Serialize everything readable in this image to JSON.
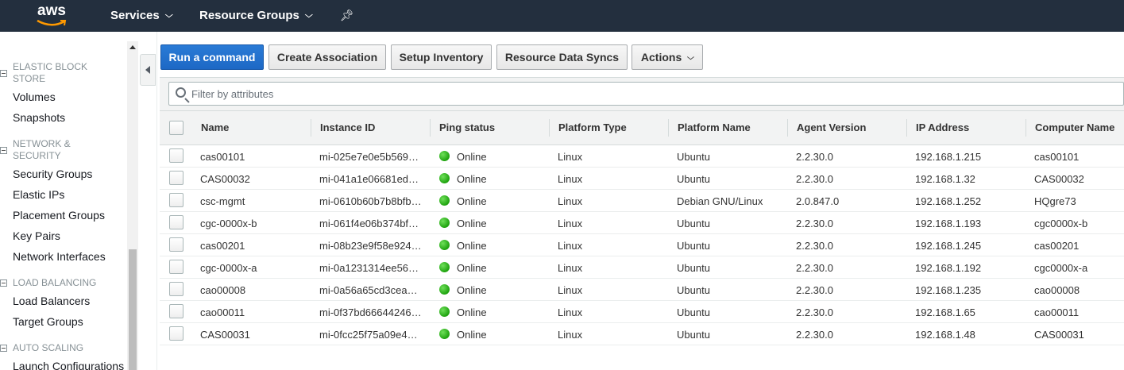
{
  "topbar": {
    "logo": "aws",
    "nav": [
      {
        "label": "Services"
      },
      {
        "label": "Resource Groups"
      }
    ]
  },
  "sidebar": {
    "sections": [
      {
        "title": "ELASTIC BLOCK STORE",
        "items": [
          "Volumes",
          "Snapshots"
        ]
      },
      {
        "title": "NETWORK & SECURITY",
        "items": [
          "Security Groups",
          "Elastic IPs",
          "Placement Groups",
          "Key Pairs",
          "Network Interfaces"
        ]
      },
      {
        "title": "LOAD BALANCING",
        "items": [
          "Load Balancers",
          "Target Groups"
        ]
      },
      {
        "title": "AUTO SCALING",
        "items": [
          "Launch Configurations"
        ]
      }
    ]
  },
  "toolbar": {
    "run_command": "Run a command",
    "create_association": "Create Association",
    "setup_inventory": "Setup Inventory",
    "resource_data_syncs": "Resource Data Syncs",
    "actions": "Actions"
  },
  "filter": {
    "placeholder": "Filter by attributes",
    "value": ""
  },
  "table": {
    "columns": [
      "Name",
      "Instance ID",
      "Ping status",
      "Platform Type",
      "Platform Name",
      "Agent Version",
      "IP Address",
      "Computer Name"
    ],
    "rows": [
      {
        "name": "cas00101",
        "instance_id": "mi-025e7e0e5b569…",
        "ping": "Online",
        "platform_type": "Linux",
        "platform_name": "Ubuntu",
        "agent_version": "2.2.30.0",
        "ip": "192.168.1.215",
        "computer_name": "cas00101"
      },
      {
        "name": "CAS00032",
        "instance_id": "mi-041a1e06681ed…",
        "ping": "Online",
        "platform_type": "Linux",
        "platform_name": "Ubuntu",
        "agent_version": "2.2.30.0",
        "ip": "192.168.1.32",
        "computer_name": "CAS00032"
      },
      {
        "name": "csc-mgmt",
        "instance_id": "mi-0610b60b7b8bfb…",
        "ping": "Online",
        "platform_type": "Linux",
        "platform_name": "Debian GNU/Linux",
        "agent_version": "2.0.847.0",
        "ip": "192.168.1.252",
        "computer_name": "HQgre73"
      },
      {
        "name": "cgc-0000x-b",
        "instance_id": "mi-061f4e06b374bf…",
        "ping": "Online",
        "platform_type": "Linux",
        "platform_name": "Ubuntu",
        "agent_version": "2.2.30.0",
        "ip": "192.168.1.193",
        "computer_name": "cgc0000x-b"
      },
      {
        "name": "cas00201",
        "instance_id": "mi-08b23e9f58e924…",
        "ping": "Online",
        "platform_type": "Linux",
        "platform_name": "Ubuntu",
        "agent_version": "2.2.30.0",
        "ip": "192.168.1.245",
        "computer_name": "cas00201"
      },
      {
        "name": "cgc-0000x-a",
        "instance_id": "mi-0a1231314ee56…",
        "ping": "Online",
        "platform_type": "Linux",
        "platform_name": "Ubuntu",
        "agent_version": "2.2.30.0",
        "ip": "192.168.1.192",
        "computer_name": "cgc0000x-a"
      },
      {
        "name": "cao00008",
        "instance_id": "mi-0a56a65cd3cea…",
        "ping": "Online",
        "platform_type": "Linux",
        "platform_name": "Ubuntu",
        "agent_version": "2.2.30.0",
        "ip": "192.168.1.235",
        "computer_name": "cao00008"
      },
      {
        "name": "cao00011",
        "instance_id": "mi-0f37bd66644246…",
        "ping": "Online",
        "platform_type": "Linux",
        "platform_name": "Ubuntu",
        "agent_version": "2.2.30.0",
        "ip": "192.168.1.65",
        "computer_name": "cao00011"
      },
      {
        "name": "CAS00031",
        "instance_id": "mi-0fcc25f75a09e4…",
        "ping": "Online",
        "platform_type": "Linux",
        "platform_name": "Ubuntu",
        "agent_version": "2.2.30.0",
        "ip": "192.168.1.48",
        "computer_name": "CAS00031"
      }
    ]
  },
  "colors": {
    "topbar": "#232f3e",
    "primary_button": "#1d68c5",
    "online_status": "#1ea20e"
  },
  "icons": {
    "pin": "pin-icon",
    "search": "search-icon",
    "chevron": "chevron-down-icon",
    "status": "status-online-icon"
  }
}
